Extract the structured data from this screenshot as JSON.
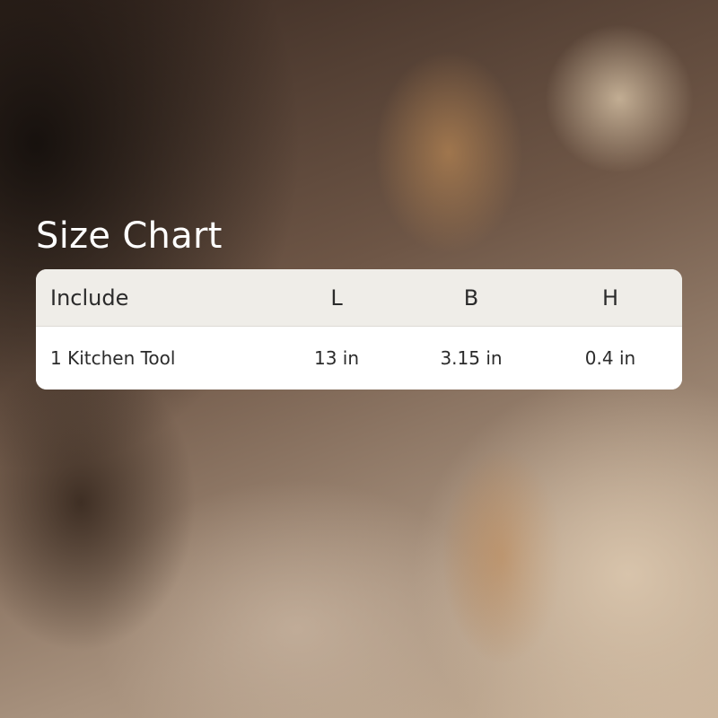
{
  "title": "Size Chart",
  "table": {
    "headers": [
      "Include",
      "L",
      "B",
      "H"
    ],
    "rows": [
      [
        "1 Kitchen Tool",
        "13 in",
        "3.15 in",
        "0.4 in"
      ]
    ]
  },
  "colors": {
    "title_text": "#ffffff",
    "header_bg": "#efede8",
    "row_bg": "#ffffff",
    "cell_text": "#2b2b2b"
  }
}
